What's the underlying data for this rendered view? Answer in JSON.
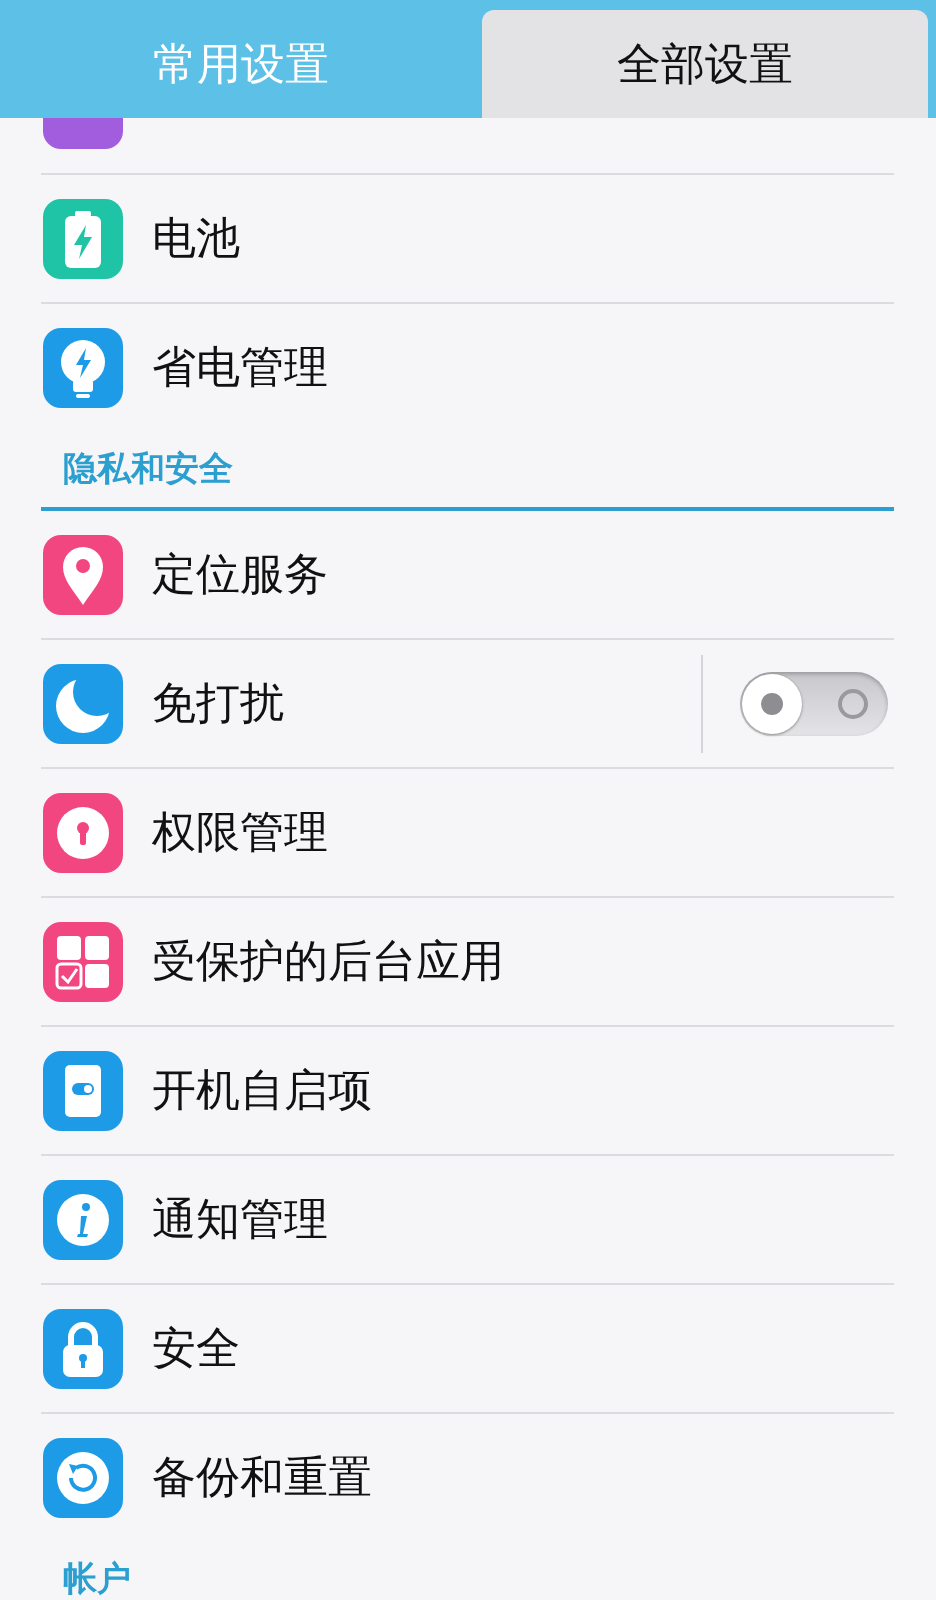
{
  "tabs": [
    {
      "label": "常用设置",
      "selected": false
    },
    {
      "label": "全部设置",
      "selected": true
    }
  ],
  "list": [
    {
      "kind": "partial_item",
      "color": "#a25ddf"
    },
    {
      "kind": "item",
      "label": "电池",
      "color": "#1fc3a5"
    },
    {
      "kind": "item",
      "label": "省电管理",
      "color": "#1d9be6"
    },
    {
      "kind": "section",
      "label": "隐私和安全"
    },
    {
      "kind": "item",
      "label": "定位服务",
      "color": "#f1467f"
    },
    {
      "kind": "toggle",
      "label": "免打扰",
      "on": false,
      "color": "#1d9be6"
    },
    {
      "kind": "item",
      "label": "权限管理",
      "color": "#f1467f"
    },
    {
      "kind": "item",
      "label": "受保护的后台应用",
      "color": "#f1467f"
    },
    {
      "kind": "item",
      "label": "开机自启项",
      "color": "#1d9be6"
    },
    {
      "kind": "item",
      "label": "通知管理",
      "color": "#1d9be6"
    },
    {
      "kind": "item",
      "label": "安全",
      "color": "#1d9be6"
    },
    {
      "kind": "item",
      "label": "备份和重置",
      "color": "#1d9be6"
    },
    {
      "kind": "section",
      "label": "帐户"
    }
  ]
}
